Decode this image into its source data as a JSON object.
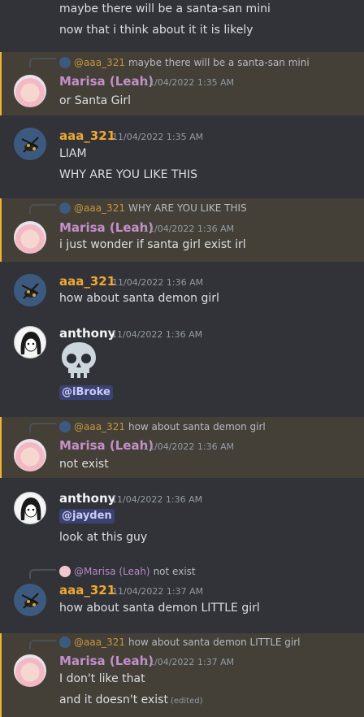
{
  "messages": {
    "m0": {
      "lines": [
        "maybe there will be a santa-san mini",
        "now that i think about it it is likely"
      ]
    },
    "m1": {
      "reply_to": {
        "name": "@aaa_321",
        "text": "maybe there will be a santa-san mini"
      },
      "author": "Marisa (Leah)",
      "time": "11/04/2022 1:35 AM",
      "lines": [
        "or Santa Girl"
      ]
    },
    "m2": {
      "author": "aaa_321",
      "time": "11/04/2022 1:35 AM",
      "lines": [
        "LIAM",
        "WHY ARE YOU LIKE THIS"
      ]
    },
    "m3": {
      "reply_to": {
        "name": "@aaa_321",
        "text": "WHY ARE YOU LIKE THIS"
      },
      "author": "Marisa (Leah)",
      "time": "11/04/2022 1:36 AM",
      "lines": [
        "i just wonder if santa girl exist irl"
      ]
    },
    "m4": {
      "author": "aaa_321",
      "time": "11/04/2022 1:36 AM",
      "lines": [
        "how about santa demon girl"
      ]
    },
    "m5": {
      "author": "anthony",
      "time": "11/04/2022 1:36 AM",
      "mention": "@iBroke",
      "emoji": "skull-emoji"
    },
    "m6": {
      "reply_to": {
        "name": "@aaa_321",
        "text": "how about santa demon girl"
      },
      "author": "Marisa (Leah)",
      "time": "11/04/2022 1:36 AM",
      "lines": [
        "not exist"
      ]
    },
    "m7": {
      "author": "anthony",
      "time": "11/04/2022 1:36 AM",
      "mention": "@jayden",
      "lines": [
        "look at this guy"
      ]
    },
    "m8": {
      "reply_to": {
        "name": "@Marisa (Leah)",
        "text": "not exist"
      },
      "author": "aaa_321",
      "time": "11/04/2022 1:37 AM",
      "lines": [
        "how about santa demon LITTLE girl"
      ]
    },
    "m9": {
      "reply_to": {
        "name": "@aaa_321",
        "text": "how about santa demon LITTLE girl"
      },
      "author": "Marisa (Leah)",
      "time": "11/04/2022 1:37 AM",
      "lines": [
        "I don't like that",
        "and it doesn't exist"
      ],
      "edited_label": "(edited)"
    }
  },
  "colors": {
    "background": "#313338",
    "mention_highlight": "#444038",
    "mention_bar": "#f0b232",
    "marisa_name": "#c48fcb",
    "aaa_name": "#f0a833",
    "mention_chip": "#3c4270"
  }
}
